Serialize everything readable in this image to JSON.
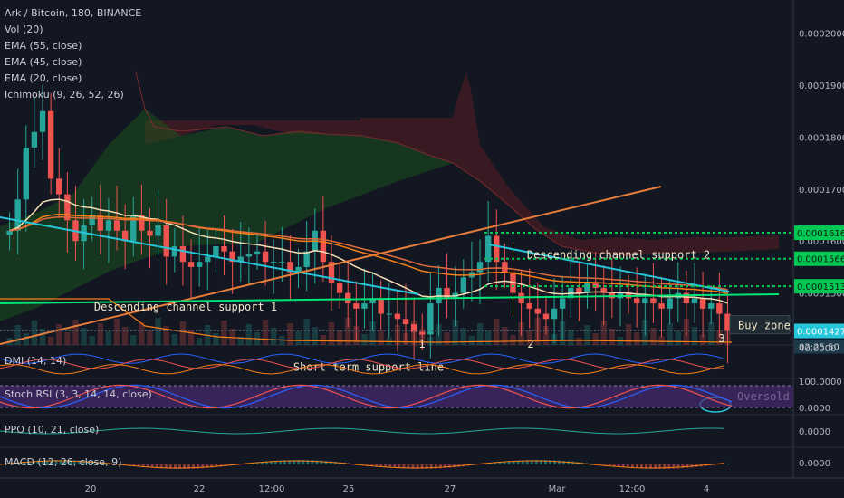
{
  "legend": {
    "title": "Ark / Bitcoin, 180, BINANCE",
    "indicators": [
      "Vol (20)",
      "EMA (55, close)",
      "EMA (45, close)",
      "EMA (20, close)",
      "Ichimoku (9, 26, 52, 26)"
    ]
  },
  "panes": {
    "dmi": "DMI (14, 14)",
    "stoch": "Stoch RSI (3, 3, 14, 14, close)",
    "ppo": "PPO (10, 21, close)",
    "macd": "MACD (12, 26, close, 9)"
  },
  "colors": {
    "bull": "#26a69a",
    "bear": "#ef5350",
    "ema20": "#f5deb3",
    "ema45": "#f57f17",
    "ema55": "#e06c3c",
    "channel": "#26c6da",
    "trendline": "#e67e3a",
    "support": "#00e676",
    "level": "#00c853",
    "cloud_bull": "#1b5e20",
    "cloud_bear": "#5a1e23",
    "stoch_band": "#4a2a73"
  },
  "chart_data": {
    "type": "candlestick",
    "symbol": "Ark / Bitcoin",
    "y_axis": {
      "ylim": [
        0.00014,
        0.000205
      ],
      "ticks": [
        "0.0002000",
        "0.0001900",
        "0.0001800",
        "0.0001700",
        "0.0001600",
        "0.0001500",
        "0.0001400"
      ]
    },
    "x_axis": {
      "ticks": [
        "20",
        "22",
        "12:00",
        "25",
        "27",
        "Mar",
        "12:00",
        "4"
      ]
    },
    "price_labels": [
      {
        "value": 0.0001616,
        "text": "0.0001616",
        "color": "#00c853"
      },
      {
        "value": 0.0001566,
        "text": "0.0001566",
        "color": "#00c853"
      },
      {
        "value": 0.0001513,
        "text": "0.0001513",
        "color": "#00c853"
      },
      {
        "value": 0.0001427,
        "text": "0.0001427",
        "color": "#26c6da"
      }
    ],
    "countdown": "02:25:50",
    "annotations": [
      {
        "text": "Descending channel support 1",
        "x": 0.21,
        "y": 0.0001466
      },
      {
        "text": "Descending channel support 2",
        "x": 0.865,
        "y": 0.0001566
      },
      {
        "text": "Short term support line",
        "x": 0.515,
        "y": 0.000135
      },
      {
        "text": "Buy zone",
        "x": 1.0,
        "y": 0.0001432
      },
      {
        "text": "1",
        "x": 0.6,
        "y": 0.0001395
      },
      {
        "text": "2",
        "x": 0.78,
        "y": 0.0001395
      },
      {
        "text": "3",
        "x": 0.985,
        "y": 0.0001405
      },
      {
        "text": "Oversold",
        "x": 0.95,
        "y": 0.9
      }
    ],
    "closes": [
      0.000162,
      0.000168,
      0.000178,
      0.000181,
      0.000185,
      0.000172,
      0.000169,
      0.000164,
      0.00016,
      0.000163,
      0.000165,
      0.000162,
      0.000164,
      0.000162,
      0.00016,
      0.000165,
      0.000162,
      0.000161,
      0.000163,
      0.000157,
      0.000159,
      0.000156,
      0.000155,
      0.000156,
      0.000157,
      0.000159,
      0.000158,
      0.000156,
      0.000157,
      0.0001575,
      0.000158,
      0.000156,
      0.000156,
      0.000156,
      0.000154,
      0.000155,
      0.000158,
      0.000162,
      0.000156,
      0.000152,
      0.00015,
      0.000148,
      0.000147,
      0.000148,
      0.000149,
      0.000146,
      0.000146,
      0.000145,
      0.000144,
      0.0001425,
      0.000142,
      0.000148,
      0.000151,
      0.000149,
      0.00015,
      0.000153,
      0.000154,
      0.000156,
      0.000161,
      0.000156,
      0.000154,
      0.00015,
      0.000148,
      0.000147,
      0.000146,
      0.000145,
      0.000147,
      0.000149,
      0.000151,
      0.00015,
      0.000152,
      0.000151,
      0.00015,
      0.000149,
      0.00015,
      0.000149,
      0.000148,
      0.000149,
      0.000148,
      0.000147,
      0.000149,
      0.00015,
      0.000148,
      0.000149,
      0.000147,
      0.000148,
      0.000146,
      0.0001427
    ],
    "stoch_ylim": [
      0,
      100
    ],
    "stoch_ticks": [
      "100.0000",
      "0.0000"
    ],
    "dmi_ticks": [
      "40.0000"
    ],
    "ppo_ticks": [
      "0.0000"
    ],
    "macd_ticks": [
      "0.0000"
    ]
  }
}
